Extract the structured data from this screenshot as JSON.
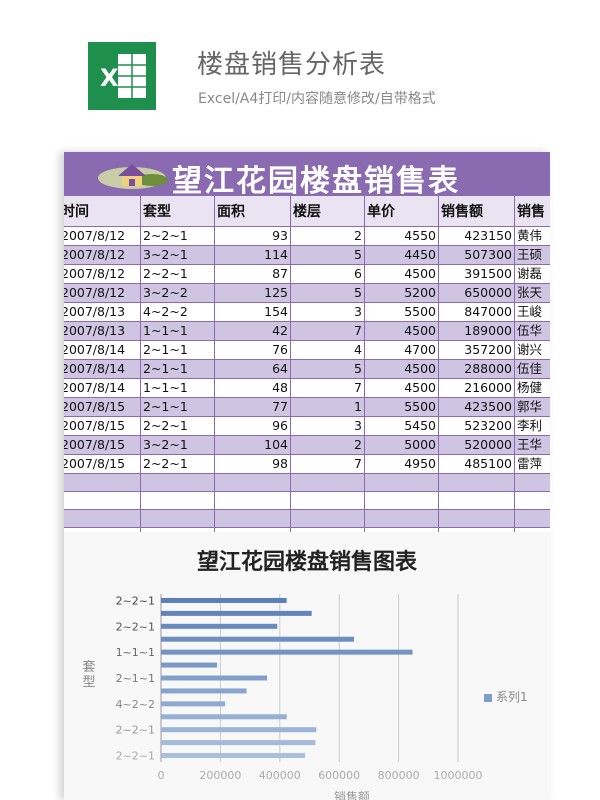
{
  "header": {
    "title": "楼盘销售分析表",
    "subtitle": "Excel/A4打印/内容随意修改/自带格式",
    "icon": "excel-icon",
    "icon_letter": "X"
  },
  "sheet": {
    "banner_title": "望江花园楼盘销售表",
    "banner_color": "#8a6ab0",
    "columns": [
      "时间",
      "套型",
      "面积",
      "楼层",
      "单价",
      "销售额",
      "销售"
    ],
    "rows": [
      [
        "2007/8/12",
        "2~2~1",
        "93",
        "2",
        "4550",
        "423150",
        "黄伟"
      ],
      [
        "2007/8/12",
        "3~2~1",
        "114",
        "5",
        "4450",
        "507300",
        "王硕"
      ],
      [
        "2007/8/12",
        "2~2~1",
        "87",
        "6",
        "4500",
        "391500",
        "谢磊"
      ],
      [
        "2007/8/12",
        "3~2~2",
        "125",
        "5",
        "5200",
        "650000",
        "张天"
      ],
      [
        "2007/8/13",
        "4~2~2",
        "154",
        "3",
        "5500",
        "847000",
        "王峻"
      ],
      [
        "2007/8/13",
        "1~1~1",
        "42",
        "7",
        "4500",
        "189000",
        "伍华"
      ],
      [
        "2007/8/14",
        "2~1~1",
        "76",
        "4",
        "4700",
        "357200",
        "谢兴"
      ],
      [
        "2007/8/14",
        "2~1~1",
        "64",
        "5",
        "4500",
        "288000",
        "伍佳"
      ],
      [
        "2007/8/14",
        "1~1~1",
        "48",
        "7",
        "4500",
        "216000",
        "杨健"
      ],
      [
        "2007/8/15",
        "2~1~1",
        "77",
        "1",
        "5500",
        "423500",
        "郭华"
      ],
      [
        "2007/8/15",
        "2~2~1",
        "96",
        "3",
        "5450",
        "523200",
        "李利"
      ],
      [
        "2007/8/15",
        "3~2~1",
        "104",
        "2",
        "5000",
        "520000",
        "王华"
      ],
      [
        "2007/8/15",
        "2~2~1",
        "98",
        "7",
        "4950",
        "485100",
        "雷萍"
      ]
    ],
    "blank_rows": 4
  },
  "chart_data": {
    "type": "bar",
    "title": "望江花园楼盘销售图表",
    "ylabel": "套型",
    "xlabel": "销售额",
    "categories": [
      "2~2~1",
      "3~2~1",
      "2~2~1",
      "3~2~2",
      "4~2~2",
      "1~1~1",
      "2~1~1",
      "2~1~1",
      "1~1~1",
      "2~1~1",
      "2~2~1",
      "3~2~1",
      "2~2~1"
    ],
    "category_tick_labels": [
      "2~2~1",
      "2~2~1",
      "1~1~1",
      "2~1~1",
      "4~2~2",
      "2~2~1",
      "2~2~1"
    ],
    "series": [
      {
        "name": "系列1",
        "values": [
          423150,
          507300,
          391500,
          650000,
          847000,
          189000,
          357200,
          288000,
          216000,
          423500,
          523200,
          520000,
          485100
        ]
      }
    ],
    "xlim": [
      0,
      1000000
    ],
    "xticks": [
      "0",
      "200000",
      "400000",
      "600000",
      "800000",
      "1000000"
    ],
    "grid": true,
    "legend": "right",
    "bar_color_top": "#5b7fb8",
    "bar_color_bottom": "#a9bfdd"
  }
}
